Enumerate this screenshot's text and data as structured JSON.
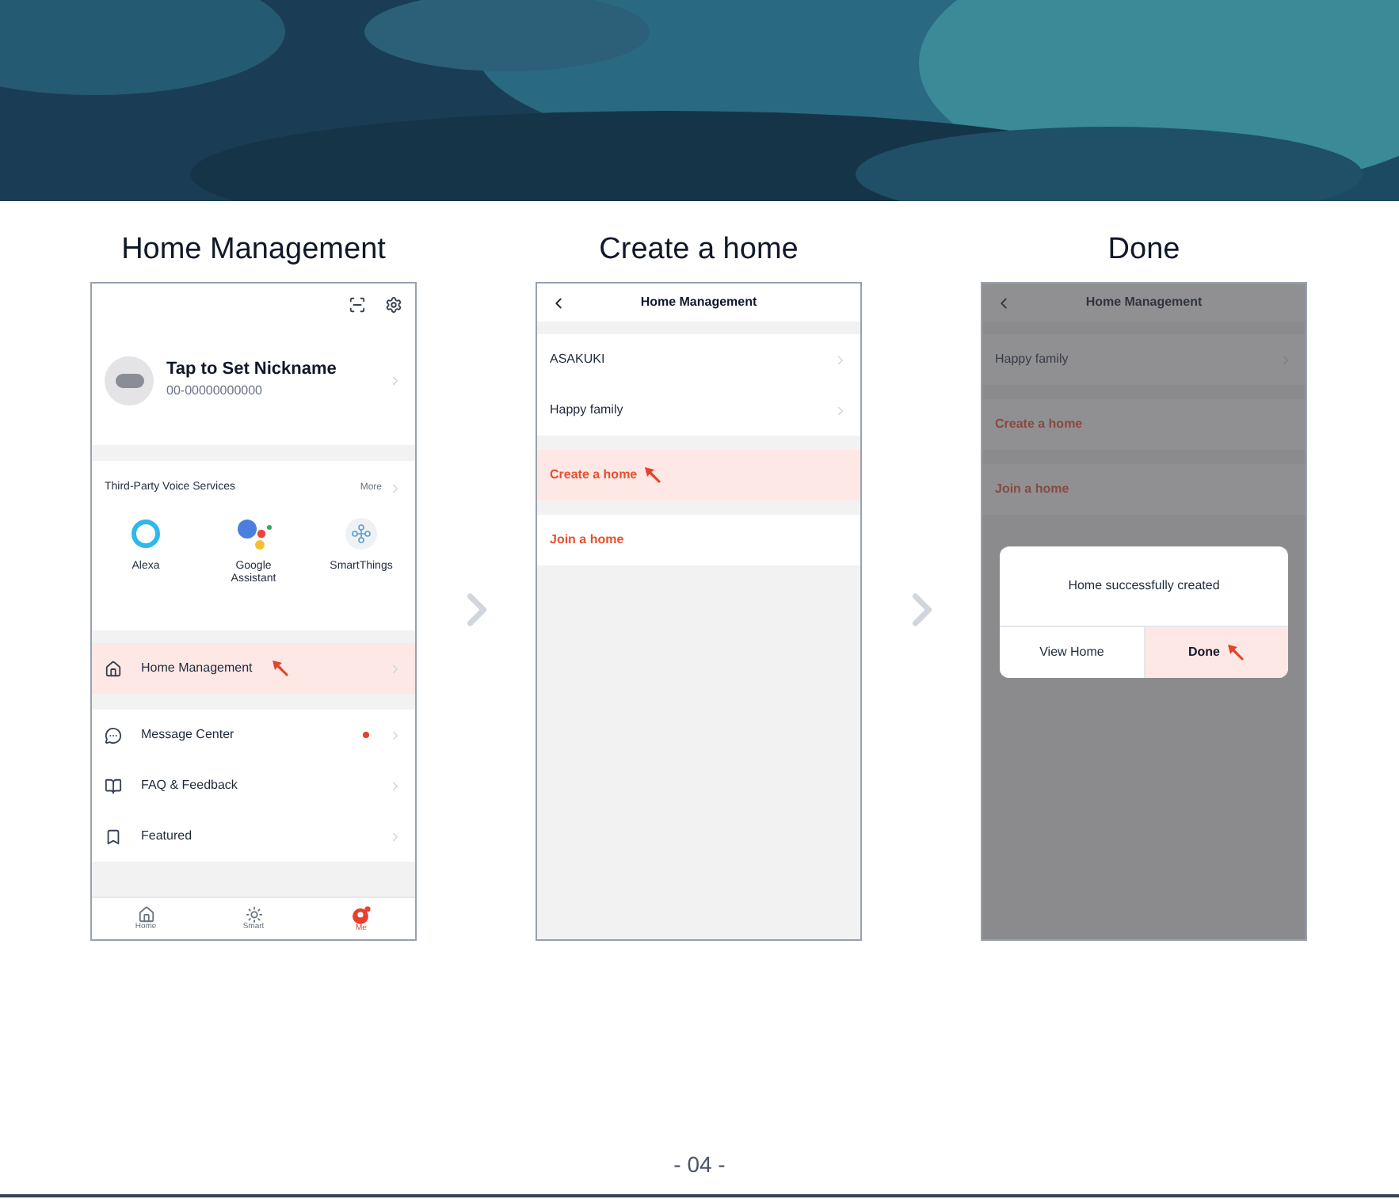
{
  "steps": [
    {
      "title": "Home Management",
      "screen": {
        "kind": "profile",
        "profile": {
          "name": "Tap to Set Nickname",
          "account": "00-00000000000"
        },
        "voice_services": {
          "title": "Third-Party Voice Services",
          "more": "More",
          "services": [
            {
              "name": "Alexa"
            },
            {
              "name": "Google Assistant"
            },
            {
              "name": "SmartThings"
            }
          ]
        },
        "menu_groups": [
          [
            {
              "label": "Home Management",
              "highlighted": true,
              "unread": false
            }
          ],
          [
            {
              "label": "Message Center",
              "highlighted": false,
              "unread": true
            },
            {
              "label": "FAQ & Feedback",
              "highlighted": false,
              "unread": false
            },
            {
              "label": "Featured",
              "highlighted": false,
              "unread": false
            }
          ]
        ],
        "tabs": [
          {
            "label": "Home",
            "selected": false
          },
          {
            "label": "Smart",
            "selected": false
          },
          {
            "label": "Me",
            "selected": true
          }
        ]
      }
    },
    {
      "title": "Create a home",
      "screen": {
        "kind": "homes",
        "header": "Home Management",
        "dimmed": false,
        "homes": [
          "ASAKUKI",
          "Happy family"
        ],
        "actions": [
          {
            "label": "Create a home",
            "highlighted": true
          },
          {
            "label": "Join a home",
            "highlighted": false
          }
        ]
      }
    },
    {
      "title": "Done",
      "screen": {
        "kind": "homes",
        "header": "Home Management",
        "dimmed": true,
        "homes": [
          "Happy family"
        ],
        "actions": [
          {
            "label": "Create a home",
            "highlighted": false
          },
          {
            "label": "Join a home",
            "highlighted": false
          }
        ],
        "dialog": {
          "message": "Home successfully created",
          "buttons": [
            {
              "label": "View Home",
              "highlighted": false
            },
            {
              "label": "Done",
              "highlighted": true
            }
          ]
        }
      }
    }
  ],
  "page_number": "- 04 -"
}
